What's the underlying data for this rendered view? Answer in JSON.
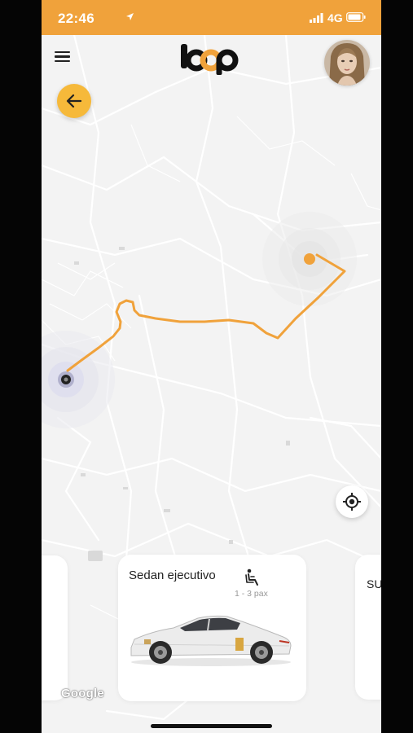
{
  "status_bar": {
    "time": "22:46",
    "network": "4G"
  },
  "header": {
    "logo_text": "loop",
    "menu_icon": "hamburger-menu-icon",
    "avatar_icon": "user-avatar"
  },
  "map": {
    "back_icon": "arrow-left-icon",
    "locate_icon": "crosshair-locate-icon",
    "attribution": "Google"
  },
  "vehicle_cards": {
    "selected": {
      "title": "Sedan ejecutivo",
      "capacity": "1 - 3 pax",
      "icon": "car-seat-icon"
    },
    "next_label": "SU"
  },
  "colors": {
    "accent": "#f0a23b",
    "route": "#f0a23b",
    "button_yellow": "#f6b93a",
    "map_bg": "#f3f3f3"
  }
}
